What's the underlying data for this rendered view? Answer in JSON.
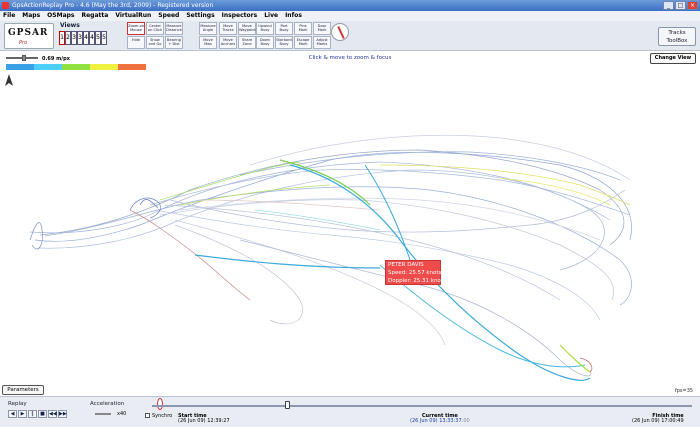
{
  "window": {
    "title": "GpsActionReplay Pro - 4.6 (May the 3rd, 2009) - Registered version",
    "min": "_",
    "max": "□",
    "close": "×"
  },
  "menu": [
    "File",
    "Maps",
    "OSMaps",
    "Regatta",
    "VirtualRun",
    "Speed",
    "Settings",
    "Inspectors",
    "Live",
    "Infos"
  ],
  "logo": {
    "text": "GPSAR",
    "sub": "Pro"
  },
  "views": {
    "label": "Views",
    "buttons": [
      "1",
      "2",
      "3",
      "3",
      "4",
      "4",
      "5",
      "5"
    ]
  },
  "tools": {
    "group1": [
      "Zoom on Mouse",
      "Center on Click",
      "Measure Distance",
      "Hide",
      "Show and Go",
      "Bearing + Dist"
    ],
    "group2": [
      "Measure Angle",
      "Move Map"
    ],
    "group3": [
      "Move Tracks",
      "Move Waypoint",
      "Move Anchors",
      "Share Zone",
      "Create Waypoint",
      "Waypoint"
    ],
    "group4": [
      "Upwind Buoy",
      "Port Buoy",
      "Pins Mark",
      "Door Mark",
      "Down Buoy",
      "Starbord Buoy",
      "Escape Mark",
      "Adjust Marks"
    ]
  },
  "tracks_toolbox": {
    "line1": "Tracks",
    "line2": "ToolBox"
  },
  "hint": "Click & move to zoom & focus",
  "change_view": "Change View",
  "scale": {
    "value": "0.69 m/px"
  },
  "speed_legend": {
    "colors": [
      "#3aa0e8",
      "#4dd0ff",
      "#90e040",
      "#f0f040",
      "#f07040"
    ]
  },
  "boat_label": {
    "name": "PETER DAVIS",
    "speed": "Speed: 25.57 knots",
    "doppler": "Doppler: 25.31 knots"
  },
  "parameters": "Parameters",
  "fps": "fps=35",
  "bottom": {
    "replay": "Replay",
    "replay_buttons": [
      "◀",
      "▶",
      "‖",
      "■",
      "◀◀",
      "▶▶"
    ],
    "acceleration": "Acceleration",
    "accel_value": "x40",
    "synchro": "Synchro",
    "start_label": "Start time",
    "start_value": "(26 Jun 09) 12:39:27",
    "current_label": "Current time",
    "current_value": "(26 Jun 09) 13:33:37",
    "current_ms": ":00",
    "finish_label": "Finish time",
    "finish_value": "(26 Jun 09) 17:00:49"
  }
}
